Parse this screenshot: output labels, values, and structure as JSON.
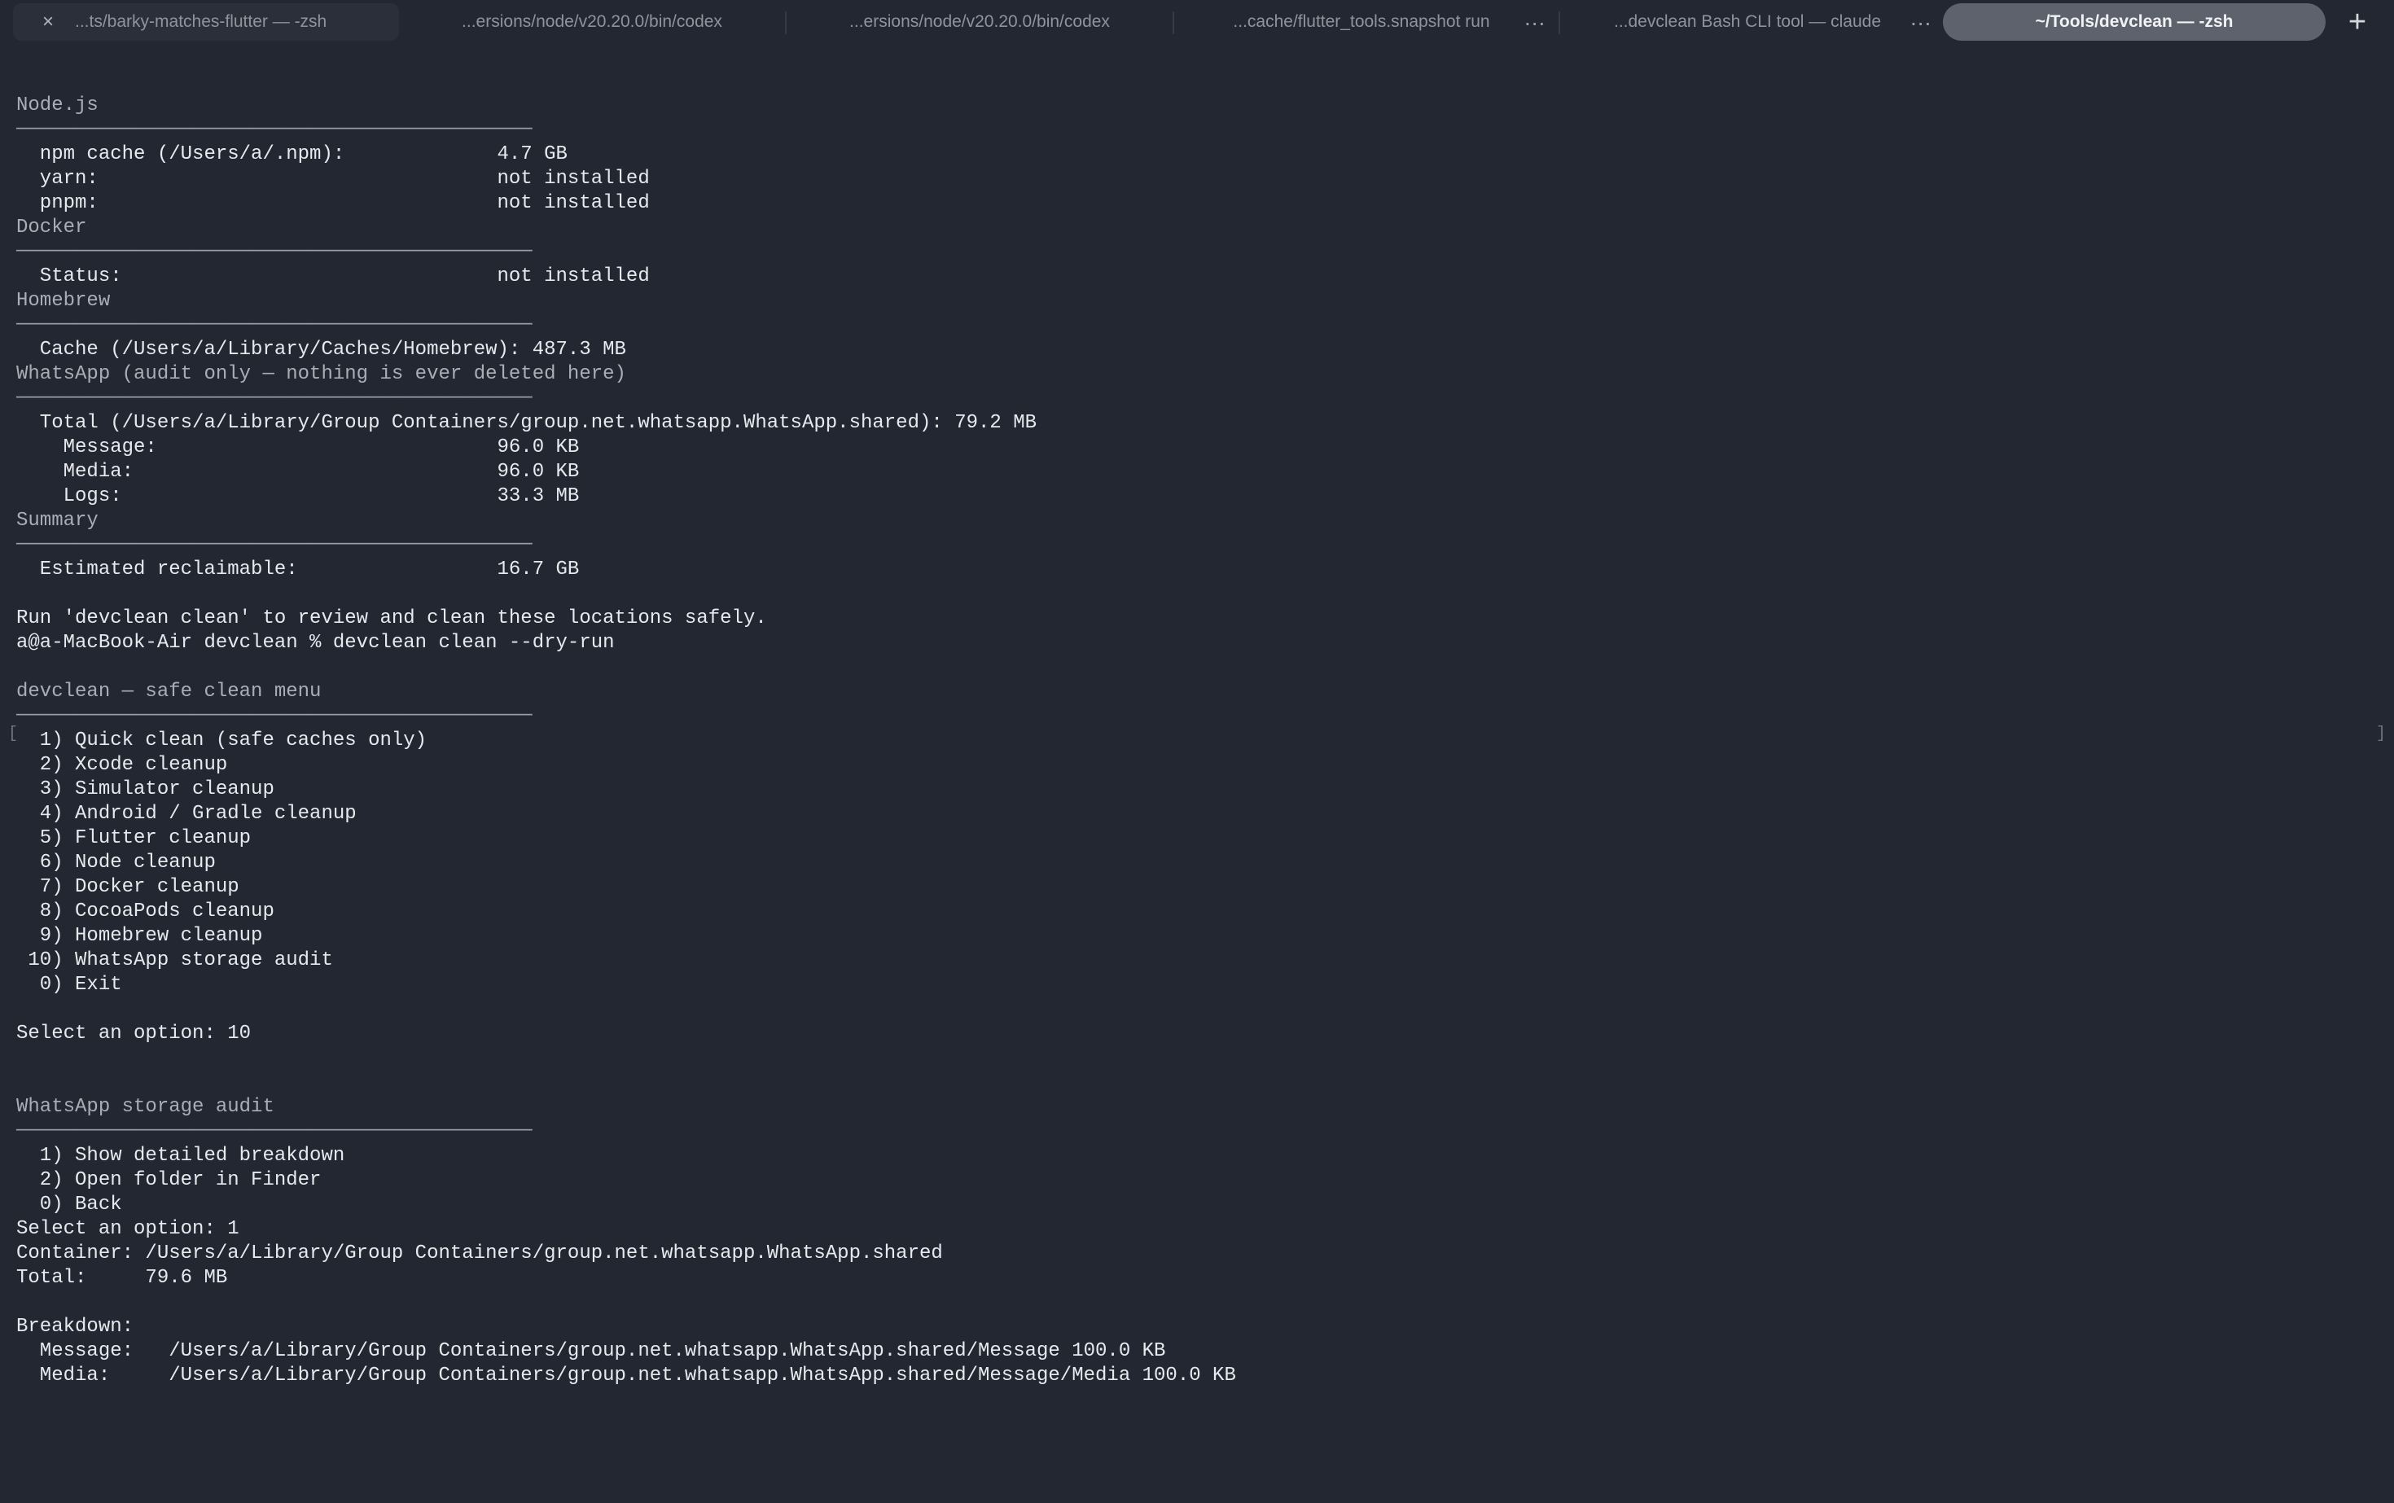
{
  "tabs": [
    {
      "label": "...ts/barky-matches-flutter — -zsh"
    },
    {
      "label": "...ersions/node/v20.20.0/bin/codex"
    },
    {
      "label": "...ersions/node/v20.20.0/bin/codex"
    },
    {
      "label": "...cache/flutter_tools.snapshot run"
    },
    {
      "label": "...devclean Bash CLI tool — claude"
    },
    {
      "label": "~/Tools/devclean — -zsh"
    }
  ],
  "icons": {
    "close": "×",
    "more": "...",
    "new_tab": "+"
  },
  "colors": {
    "background": "#222731",
    "active_tab": "#5d626d",
    "text": "#e7e9ed",
    "heading": "#a9aeb6"
  },
  "terminal": {
    "lines": [
      {
        "style": "heading",
        "text": "Node.js"
      },
      {
        "style": "rule",
        "text": "────────────────────────────────────────────"
      },
      {
        "style": "out",
        "text": "  npm cache (/Users/a/.npm):             4.7 GB"
      },
      {
        "style": "out",
        "text": "  yarn:                                  not installed"
      },
      {
        "style": "out",
        "text": "  pnpm:                                  not installed"
      },
      {
        "style": "heading",
        "text": "Docker"
      },
      {
        "style": "rule",
        "text": "────────────────────────────────────────────"
      },
      {
        "style": "out",
        "text": "  Status:                                not installed"
      },
      {
        "style": "heading",
        "text": "Homebrew"
      },
      {
        "style": "rule",
        "text": "────────────────────────────────────────────"
      },
      {
        "style": "out",
        "text": "  Cache (/Users/a/Library/Caches/Homebrew): 487.3 MB"
      },
      {
        "style": "heading",
        "text": "WhatsApp (audit only — nothing is ever deleted here)"
      },
      {
        "style": "rule",
        "text": "────────────────────────────────────────────"
      },
      {
        "style": "out",
        "text": "  Total (/Users/a/Library/Group Containers/group.net.whatsapp.WhatsApp.shared): 79.2 MB"
      },
      {
        "style": "out",
        "text": "    Message:                             96.0 KB"
      },
      {
        "style": "out",
        "text": "    Media:                               96.0 KB"
      },
      {
        "style": "out",
        "text": "    Logs:                                33.3 MB"
      },
      {
        "style": "heading",
        "text": "Summary"
      },
      {
        "style": "rule",
        "text": "────────────────────────────────────────────"
      },
      {
        "style": "out",
        "text": "  Estimated reclaimable:                 16.7 GB"
      },
      {
        "style": "blank",
        "text": ""
      },
      {
        "style": "out",
        "text": "Run 'devclean clean' to review and clean these locations safely."
      },
      {
        "style": "out",
        "text": "a@a-MacBook-Air devclean % devclean clean --dry-run"
      },
      {
        "style": "blank",
        "text": ""
      },
      {
        "style": "heading",
        "text": "devclean — safe clean menu"
      },
      {
        "style": "rule",
        "text": "────────────────────────────────────────────"
      },
      {
        "style": "out",
        "text": "  1) Quick clean (safe caches only)"
      },
      {
        "style": "out",
        "text": "  2) Xcode cleanup"
      },
      {
        "style": "out",
        "text": "  3) Simulator cleanup"
      },
      {
        "style": "out",
        "text": "  4) Android / Gradle cleanup"
      },
      {
        "style": "out",
        "text": "  5) Flutter cleanup"
      },
      {
        "style": "out",
        "text": "  6) Node cleanup"
      },
      {
        "style": "out",
        "text": "  7) Docker cleanup"
      },
      {
        "style": "out",
        "text": "  8) CocoaPods cleanup"
      },
      {
        "style": "out",
        "text": "  9) Homebrew cleanup"
      },
      {
        "style": "out",
        "text": " 10) WhatsApp storage audit"
      },
      {
        "style": "out",
        "text": "  0) Exit"
      },
      {
        "style": "blank",
        "text": ""
      },
      {
        "style": "out",
        "text": "Select an option: 10"
      },
      {
        "style": "blank",
        "text": ""
      },
      {
        "style": "blank",
        "text": ""
      },
      {
        "style": "heading",
        "text": "WhatsApp storage audit"
      },
      {
        "style": "rule",
        "text": "────────────────────────────────────────────"
      },
      {
        "style": "out",
        "text": "  1) Show detailed breakdown"
      },
      {
        "style": "out",
        "text": "  2) Open folder in Finder"
      },
      {
        "style": "out",
        "text": "  0) Back"
      },
      {
        "style": "out",
        "text": "Select an option: 1"
      },
      {
        "style": "out",
        "text": "Container: /Users/a/Library/Group Containers/group.net.whatsapp.WhatsApp.shared"
      },
      {
        "style": "out",
        "text": "Total:     79.6 MB"
      },
      {
        "style": "blank",
        "text": ""
      },
      {
        "style": "out",
        "text": "Breakdown:"
      },
      {
        "style": "out",
        "text": "  Message:   /Users/a/Library/Group Containers/group.net.whatsapp.WhatsApp.shared/Message 100.0 KB"
      },
      {
        "style": "out",
        "text": "  Media:     /Users/a/Library/Group Containers/group.net.whatsapp.WhatsApp.shared/Message/Media 100.0 KB"
      }
    ]
  }
}
